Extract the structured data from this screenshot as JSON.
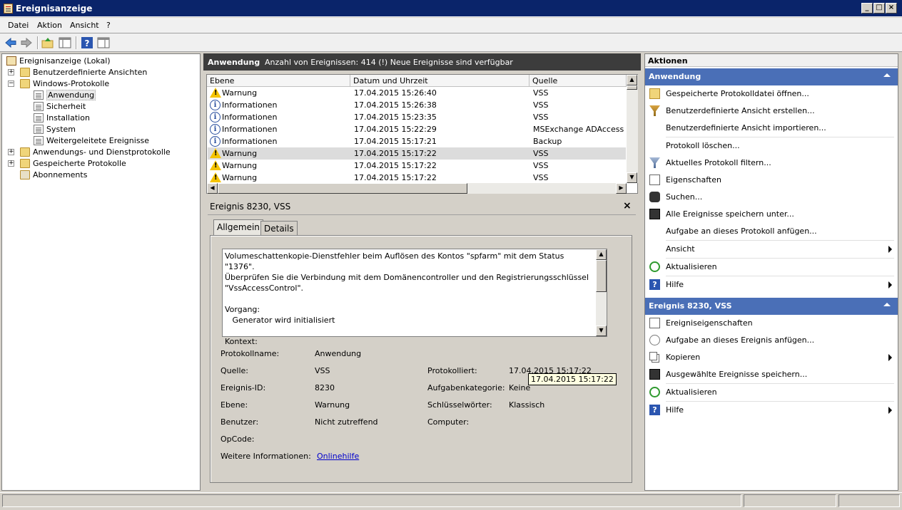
{
  "window": {
    "title": "Ereignisanzeige",
    "min_glyph": "_",
    "max_glyph": "□",
    "close_glyph": "×"
  },
  "menu": [
    "Datei",
    "Aktion",
    "Ansicht",
    "?"
  ],
  "tree": {
    "root": "Ereignisanzeige (Lokal)",
    "items": [
      {
        "label": "Benutzerdefinierte Ansichten",
        "icon": "folder-icon",
        "expander": "+"
      },
      {
        "label": "Windows-Protokolle",
        "icon": "folder-icon",
        "expander": "−"
      },
      {
        "label": "Anwendung",
        "icon": "log-icon",
        "selected": true
      },
      {
        "label": "Sicherheit",
        "icon": "log-icon"
      },
      {
        "label": "Installation",
        "icon": "log-icon"
      },
      {
        "label": "System",
        "icon": "log-icon"
      },
      {
        "label": "Weitergeleitete Ereignisse",
        "icon": "log-icon"
      },
      {
        "label": "Anwendungs- und Dienstprotokolle",
        "icon": "folder-icon",
        "expander": "+"
      },
      {
        "label": "Gespeicherte Protokolle",
        "icon": "folder-icon",
        "expander": "+"
      },
      {
        "label": "Abonnements",
        "icon": "subscription-icon"
      }
    ]
  },
  "center": {
    "header_title": "Anwendung",
    "header_info": "Anzahl von Ereignissen: 414 (!) Neue Ereignisse sind verfügbar",
    "columns": [
      "Ebene",
      "Datum und Uhrzeit",
      "Quelle"
    ],
    "events": [
      {
        "level": "Warnung",
        "icon": "warning-icon",
        "datetime": "17.04.2015 15:26:40",
        "source": "VSS"
      },
      {
        "level": "Informationen",
        "icon": "info-icon",
        "datetime": "17.04.2015 15:26:38",
        "source": "VSS"
      },
      {
        "level": "Informationen",
        "icon": "info-icon",
        "datetime": "17.04.2015 15:23:35",
        "source": "VSS"
      },
      {
        "level": "Informationen",
        "icon": "info-icon",
        "datetime": "17.04.2015 15:22:29",
        "source": "MSExchange ADAccess"
      },
      {
        "level": "Informationen",
        "icon": "info-icon",
        "datetime": "17.04.2015 15:17:21",
        "source": "Backup"
      },
      {
        "level": "Warnung",
        "icon": "warning-icon",
        "datetime": "17.04.2015 15:17:22",
        "source": "VSS",
        "selected": true
      },
      {
        "level": "Warnung",
        "icon": "warning-icon",
        "datetime": "17.04.2015 15:17:22",
        "source": "VSS"
      },
      {
        "level": "Warnung",
        "icon": "warning-icon",
        "datetime": "17.04.2015 15:17:22",
        "source": "VSS"
      }
    ],
    "detail": {
      "title": "Ereignis 8230, VSS",
      "close_glyph": "×",
      "tabs": [
        "Allgemein",
        "Details"
      ],
      "description": "Volumeschattenkopie-Dienstfehler beim Auflösen des Kontos \"spfarm\" mit dem Status \"1376\".\nÜberprüfen Sie die Verbindung mit dem Domänencontroller und den Registrierungsschlüssel\n\"VssAccessControl\".\n\nVorgang:\n   Generator wird initialisiert\n\nKontext:",
      "props": {
        "protokollname_label": "Protokollname:",
        "protokollname": "Anwendung",
        "quelle_label": "Quelle:",
        "quelle": "VSS",
        "protokolliert_label": "Protokolliert:",
        "protokolliert": "17.04.2015 15:17:22",
        "ereignis_id_label": "Ereignis-ID:",
        "ereignis_id": "8230",
        "aufgabenkategorie_label": "Aufgabenkategorie:",
        "aufgabenkategorie": "Keine",
        "ebene_label": "Ebene:",
        "ebene": "Warnung",
        "schluesselwoerter_label": "Schlüsselwörter:",
        "schluesselwoerter": "Klassisch",
        "benutzer_label": "Benutzer:",
        "benutzer": "Nicht zutreffend",
        "computer_label": "Computer:",
        "opcode_label": "OpCode:",
        "weitere_label": "Weitere Informationen:",
        "weitere_link": "Onlinehilfe"
      },
      "tooltip": "17.04.2015 15:17:22"
    }
  },
  "actions": {
    "header": "Aktionen",
    "section1": {
      "title": "Anwendung",
      "items": [
        {
          "label": "Gespeicherte Protokolldatei öffnen...",
          "icon": "open-folder-icon"
        },
        {
          "label": "Benutzerdefinierte Ansicht erstellen...",
          "icon": "filter-icon"
        },
        {
          "label": "Benutzerdefinierte Ansicht importieren...",
          "icon": ""
        },
        {
          "label": "Protokoll löschen...",
          "icon": ""
        },
        {
          "label": "Aktuelles Protokoll filtern...",
          "icon": "filter-icon"
        },
        {
          "label": "Eigenschaften",
          "icon": "properties-icon"
        },
        {
          "label": "Suchen...",
          "icon": "binoculars-icon"
        },
        {
          "label": "Alle Ereignisse speichern unter...",
          "icon": "save-icon"
        },
        {
          "label": "Aufgabe an dieses Protokoll anfügen...",
          "icon": ""
        },
        {
          "label": "Ansicht",
          "icon": "",
          "submenu": true
        },
        {
          "label": "Aktualisieren",
          "icon": "refresh-icon"
        },
        {
          "label": "Hilfe",
          "icon": "help-icon",
          "submenu": true
        }
      ]
    },
    "section2": {
      "title": "Ereignis 8230, VSS",
      "items": [
        {
          "label": "Ereigniseigenschaften",
          "icon": "properties-icon"
        },
        {
          "label": "Aufgabe an dieses Ereignis anfügen...",
          "icon": "task-icon"
        },
        {
          "label": "Kopieren",
          "icon": "copy-icon",
          "submenu": true
        },
        {
          "label": "Ausgewählte Ereignisse speichern...",
          "icon": "save-icon"
        },
        {
          "label": "Aktualisieren",
          "icon": "refresh-icon"
        },
        {
          "label": "Hilfe",
          "icon": "help-icon",
          "submenu": true
        }
      ]
    }
  },
  "colors": {
    "titlebar": "#0a246a",
    "section_header": "#4a6fb7",
    "warning": "#f5c400",
    "info": "#2a4f9e",
    "link": "#0000cc"
  }
}
